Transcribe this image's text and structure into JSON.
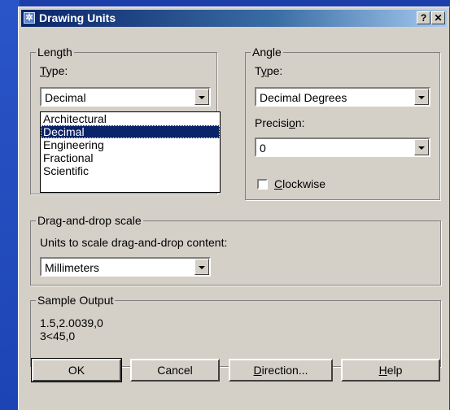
{
  "window": {
    "title": "Drawing Units",
    "help_btn": "?",
    "close_btn": "✕"
  },
  "length": {
    "group": "Length",
    "type_label": "Type:",
    "type_value": "Decimal",
    "options": [
      "Architectural",
      "Decimal",
      "Engineering",
      "Fractional",
      "Scientific"
    ],
    "selected_option": "Decimal"
  },
  "angle": {
    "group": "Angle",
    "type_label": "Type:",
    "type_value": "Decimal Degrees",
    "precision_label": "Precision:",
    "precision_value": "0",
    "clockwise_label": "Clockwise",
    "clockwise_checked": false
  },
  "dragdrop": {
    "group": "Drag-and-drop scale",
    "units_label": "Units to scale drag-and-drop content:",
    "units_value": "Millimeters"
  },
  "sample": {
    "group": "Sample Output",
    "line1": "1.5,2.0039,0",
    "line2": "3<45,0"
  },
  "buttons": {
    "ok": "OK",
    "cancel": "Cancel",
    "direction": "Direction...",
    "help": "Help"
  }
}
